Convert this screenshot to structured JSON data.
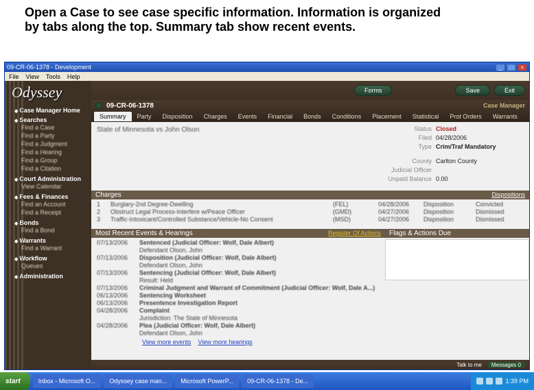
{
  "slide": {
    "line1": "Open a Case to see case specific information.  Information is organized",
    "line2": "by tabs along the top. Summary tab show recent events."
  },
  "window": {
    "title": "09-CR-06-1378 - Development"
  },
  "menu": {
    "file": "File",
    "view": "View",
    "tools": "Tools",
    "help": "Help"
  },
  "logo": "Odyssey",
  "nav": {
    "home": "Case Manager Home",
    "searches": "Searches",
    "search_items": [
      "Find a Case",
      "Find a Party",
      "Find a Judgment",
      "Find a Hearing",
      "Find a Group",
      "Find a Citation"
    ],
    "court": "Court Administration",
    "court_items": [
      "View Calendar"
    ],
    "fees": "Fees & Finances",
    "fees_items": [
      "Find an Account",
      "Find a Receipt"
    ],
    "bonds": "Bonds",
    "bonds_items": [
      "Find a Bond"
    ],
    "warrants": "Warrants",
    "warrants_items": [
      "Find a Warrant"
    ],
    "workflow": "Workflow",
    "workflow_items": [
      "Queues"
    ],
    "admin": "Administration"
  },
  "topbar": {
    "forms": "Forms",
    "save": "Save",
    "exit": "Exit",
    "cm": "Case Manager"
  },
  "case_number": "09-CR-06-1378",
  "tabs": [
    "Summary",
    "Party",
    "Disposition",
    "Charges",
    "Events",
    "Financial",
    "Bonds",
    "Conditions",
    "Placement",
    "Statistical",
    "Prot Orders",
    "Warrants"
  ],
  "case_title": "State of Minnesota vs John Olson",
  "summary": {
    "status_k": "Status",
    "status_v": "Closed",
    "filed_k": "Filed",
    "filed_v": "04/28/2006",
    "type_k": "Type",
    "type_v": "Crim/Traf Mandatory",
    "county_k": "County",
    "county_v": "Carlton County",
    "judge_k": "Judicial Officer",
    "judge_v": "",
    "amt_k": "Unpaid Balance",
    "amt_v": "0.00"
  },
  "charges_hdr": "Charges",
  "dispositions_link": "Dispositions",
  "charges": [
    {
      "n": "1",
      "desc": "Burglary-2nd Degree-Dwelling",
      "code": "(FEL)",
      "date": "04/28/2006",
      "disp": "Disposition",
      "res": "Convicted"
    },
    {
      "n": "2",
      "desc": "Obstruct Legal Process-Interfere w/Peace Officer",
      "code": "(GMD)",
      "date": "04/27/2006",
      "disp": "Disposition",
      "res": "Dismissed"
    },
    {
      "n": "3",
      "desc": "Traffic-Intoxicant/Controlled Substance/Vehicle-No Consent",
      "code": "(MSD)",
      "date": "04/27/2006",
      "disp": "Disposition",
      "res": "Dismissed"
    }
  ],
  "events_hdr": "Most Recent Events & Hearings",
  "roa_link": "Register Of Actions",
  "flags_hdr": "Flags   &   Actions Due",
  "events": [
    {
      "d": "07/13/2006",
      "t": "Sentenced",
      "sub": "(Judicial Officer: Wolf, Dale Albert)",
      "d2": "Defendant Olson, John"
    },
    {
      "d": "07/13/2006",
      "t": "Disposition",
      "sub": "(Judicial Officer: Wolf, Dale Albert)",
      "d2": "Defendant Olson, John"
    },
    {
      "d": "07/13/2006",
      "t": "Sentencing",
      "sub": "(Judicial Officer: Wolf, Dale Albert)",
      "d2": "Result: Held"
    },
    {
      "d": "07/13/2006",
      "t": "Criminal Judgment and Warrant of Commitment",
      "sub": "(Judicial Officer: Wolf, Dale A...)",
      "d2": ""
    },
    {
      "d": "06/13/2006",
      "t": "Sentencing Worksheet",
      "sub": "",
      "d2": ""
    },
    {
      "d": "06/13/2006",
      "t": "Presentence Investigation Report",
      "sub": "",
      "d2": ""
    },
    {
      "d": "04/28/2006",
      "t": "Complaint",
      "sub": "",
      "d2": "Jurisdiction: The State of Minnesota"
    },
    {
      "d": "04/28/2006",
      "t": "Plea",
      "sub": "(Judicial Officer: Wolf, Dale Albert)",
      "d2": "Defendant Olson, John"
    }
  ],
  "more_events": "View more events",
  "more_hearings": "View more hearings",
  "status": {
    "talk": "Talk to me",
    "msg": "Messages",
    "n": "0"
  },
  "taskbar": {
    "start": "start",
    "items": [
      "Inbox - Microsoft O...",
      "Odyssey case man...",
      "Microsoft PowerP...",
      "09-CR-06-1378 - De..."
    ],
    "time": "1:39 PM"
  }
}
